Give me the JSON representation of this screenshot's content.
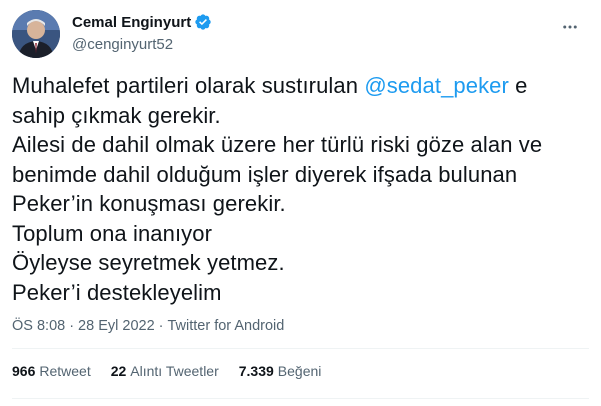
{
  "author": {
    "display_name": "Cemal Enginyurt",
    "handle": "@cenginyurt52",
    "verified_icon": "verified-badge-icon"
  },
  "tweet": {
    "lines": [
      {
        "before": "Muhalefet partileri olarak sustırulan ",
        "mention": "@sedat_peker",
        "after": " e"
      },
      {
        "text": "sahip çıkmak gerekir."
      },
      {
        "text": "Ailesi de dahil olmak üzere her türlü riski göze alan ve"
      },
      {
        "text": "benimde dahil olduğum işler diyerek ifşada bulunan"
      },
      {
        "text": "Peker’in konuşması gerekir."
      },
      {
        "text": "Toplum ona inanıyor"
      },
      {
        "text": "Öyleyse seyretmek yetmez."
      },
      {
        "text": "Peker’i destekleyelim"
      }
    ]
  },
  "meta": {
    "time": "ÖS 8:08",
    "separator": "·",
    "date": "28 Eyl 2022",
    "source": "Twitter for Android"
  },
  "stats": {
    "retweets": {
      "count": "966",
      "label": "Retweet"
    },
    "quotes": {
      "count": "22",
      "label": "Alıntı Tweetler"
    },
    "likes": {
      "count": "7.339",
      "label": "Beğeni"
    }
  },
  "colors": {
    "accent": "#1d9bf0",
    "text_primary": "#0f1419",
    "text_secondary": "#536471",
    "divider": "#eff3f4"
  }
}
